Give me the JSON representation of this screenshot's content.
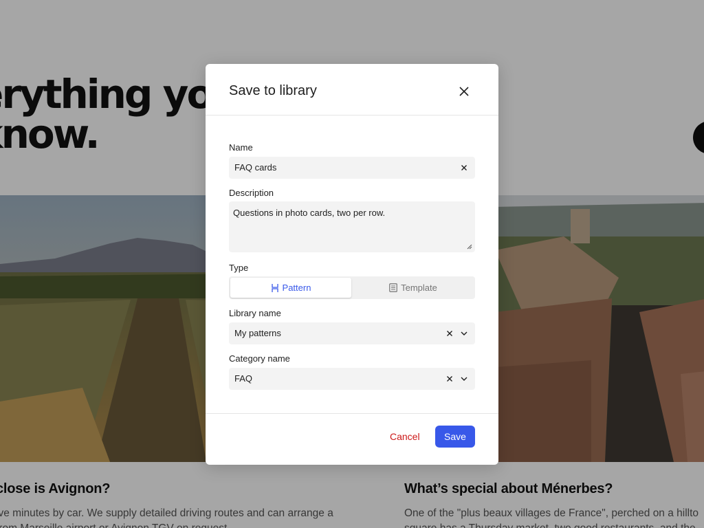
{
  "background": {
    "hero_lines": [
      "erything you n",
      "know."
    ],
    "cards": [
      {
        "question": "close is Avignon?",
        "answer": "ive minutes by car. We supply detailed driving routes and can arrange a",
        "answer2": "from Marseille airport or Avignon TGV on request."
      },
      {
        "question": "What’s special about Ménerbes?",
        "answer": "One of the \"plus beaux villages de France\", perched on a hillto",
        "answer2": "square has a Thursday market, two good restaurants, and the"
      }
    ]
  },
  "modal": {
    "title": "Save to library",
    "close_icon": "close-icon",
    "name": {
      "label": "Name",
      "value": "FAQ cards"
    },
    "description": {
      "label": "Description",
      "value": "Questions in photo cards, two per row."
    },
    "type": {
      "label": "Type",
      "options": [
        {
          "label": "Pattern",
          "icon": "pattern-icon",
          "selected": true
        },
        {
          "label": "Template",
          "icon": "template-icon",
          "selected": false
        }
      ]
    },
    "library": {
      "label": "Library name",
      "value": "My patterns"
    },
    "category": {
      "label": "Category name",
      "value": "FAQ"
    },
    "cancel_label": "Cancel",
    "save_label": "Save"
  },
  "colors": {
    "accent": "#3858e9",
    "destructive": "#cc1818",
    "field_bg": "#f3f3f3"
  }
}
